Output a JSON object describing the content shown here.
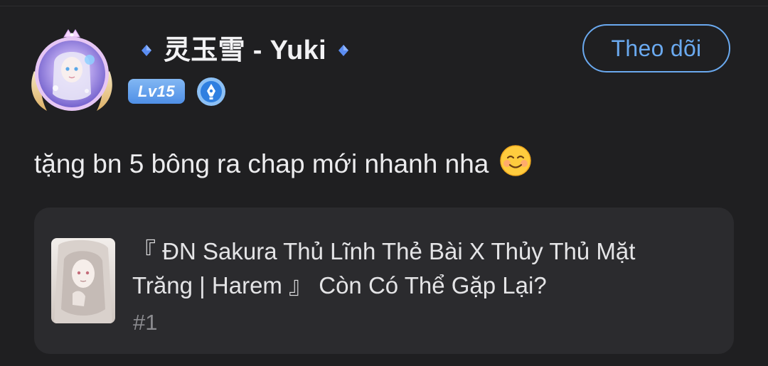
{
  "user": {
    "name": "灵玉雪 - Yuki",
    "level": "Lv15"
  },
  "icons": {
    "avatar": "avatar-frame-icon",
    "diamond": "diamond-icon",
    "writer": "pen-badge-icon",
    "emoji": "smiling-face-icon"
  },
  "follow_button": {
    "label": "Theo dõi"
  },
  "comment": {
    "text": "tặng bn 5 bông ra chap mới nhanh nha"
  },
  "story": {
    "title": "『 ĐN Sakura Thủ Lĩnh Thẻ Bài X Thủy Thủ Mặt Trăng | Harem 』 Còn Có Thể Gặp Lại?",
    "chapter": "#1"
  },
  "colors": {
    "background": "#1f1f21",
    "card": "#2b2b2e",
    "accent": "#6aa9ef",
    "level_badge": "#5f9cec",
    "muted_text": "#8b8b8f"
  }
}
